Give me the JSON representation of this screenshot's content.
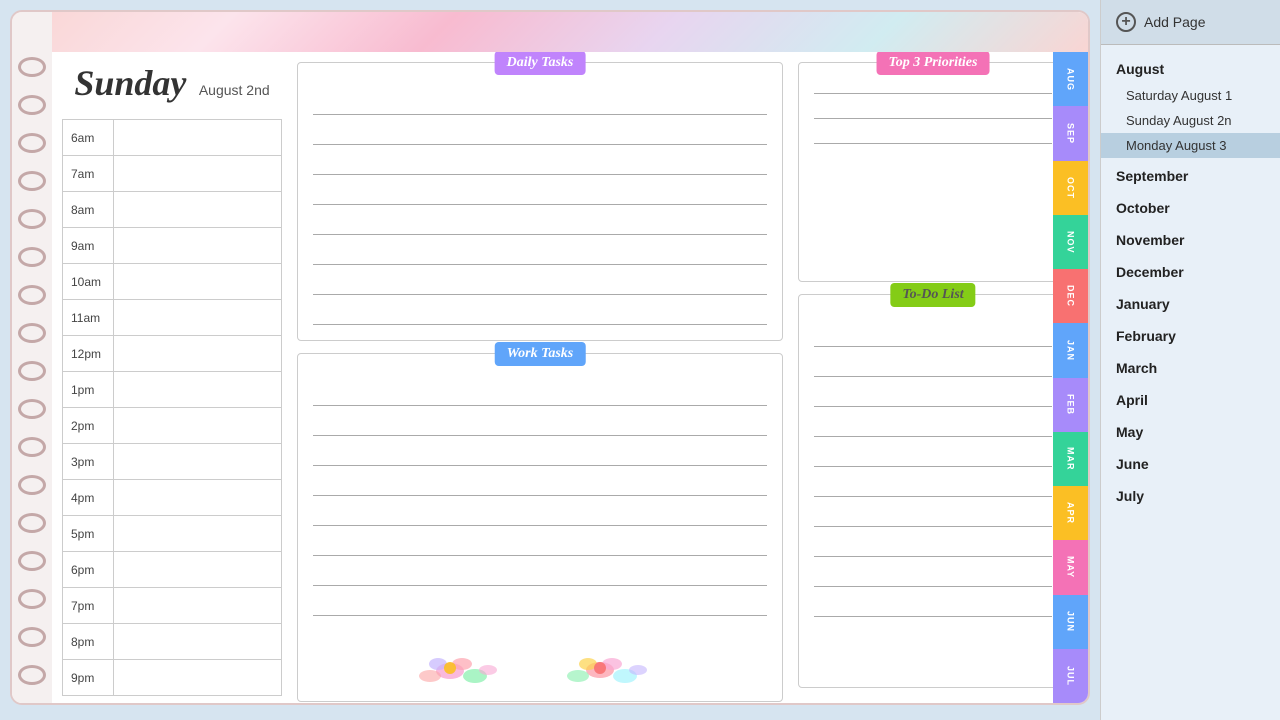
{
  "header": {
    "add_page_label": "Add Page",
    "resize_icon": "⤢"
  },
  "planner": {
    "day_name": "Sunday",
    "day_date": "August 2nd",
    "floral_strip_exists": true,
    "time_slots": [
      "6am",
      "7am",
      "8am",
      "9am",
      "10am",
      "11am",
      "12pm",
      "1pm",
      "2pm",
      "3pm",
      "4pm",
      "5pm",
      "6pm",
      "7pm",
      "8pm",
      "9pm"
    ],
    "sections": {
      "daily_tasks_label": "Daily Tasks",
      "work_tasks_label": "Work Tasks",
      "top3_label": "Top 3 Priorities",
      "todo_label": "To-Do List"
    },
    "tabs": [
      {
        "id": "aug",
        "label": "AUG"
      },
      {
        "id": "sep",
        "label": "SEP"
      },
      {
        "id": "oct",
        "label": "OCT"
      },
      {
        "id": "nov",
        "label": "NOV"
      },
      {
        "id": "dec",
        "label": "DEC"
      },
      {
        "id": "jan",
        "label": "JAN"
      },
      {
        "id": "feb",
        "label": "FEB"
      },
      {
        "id": "mar",
        "label": "MAR"
      },
      {
        "id": "apr",
        "label": "APR"
      },
      {
        "id": "may",
        "label": "MAY"
      },
      {
        "id": "jun",
        "label": "JUN"
      },
      {
        "id": "jul",
        "label": "JUL"
      }
    ]
  },
  "sidebar": {
    "months": [
      {
        "name": "August",
        "expanded": true,
        "days": [
          {
            "label": "Saturday August 1",
            "active": false
          },
          {
            "label": "Sunday August 2n",
            "active": false
          },
          {
            "label": "Monday August 3",
            "active": true
          }
        ]
      },
      {
        "name": "September",
        "expanded": false,
        "days": []
      },
      {
        "name": "October",
        "expanded": false,
        "days": []
      },
      {
        "name": "November",
        "expanded": false,
        "days": []
      },
      {
        "name": "December",
        "expanded": false,
        "days": []
      },
      {
        "name": "January",
        "expanded": false,
        "days": []
      },
      {
        "name": "February",
        "expanded": false,
        "days": []
      },
      {
        "name": "March",
        "expanded": false,
        "days": []
      },
      {
        "name": "April",
        "expanded": false,
        "days": []
      },
      {
        "name": "May",
        "expanded": false,
        "days": []
      },
      {
        "name": "June",
        "expanded": false,
        "days": []
      },
      {
        "name": "July",
        "expanded": false,
        "days": []
      }
    ]
  }
}
